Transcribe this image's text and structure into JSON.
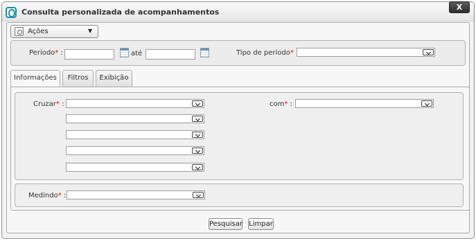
{
  "window": {
    "title": "Consulta personalizada de acompanhamentos",
    "close_label": "X"
  },
  "toolbar": {
    "actions_label": "Ações",
    "actions_caret": "▼"
  },
  "period": {
    "label": "Período",
    "required_mark": "*",
    "separator": ":",
    "start_value": "",
    "between_label": "até",
    "end_value": "",
    "type_label": "Tipo de período",
    "type_value": ""
  },
  "tabs": [
    {
      "label": "Informações",
      "active": true
    },
    {
      "label": "Filtros",
      "active": false
    },
    {
      "label": "Exibição",
      "active": false
    }
  ],
  "info": {
    "cross_label": "Cruzar",
    "cross_values": [
      "",
      "",
      "",
      "",
      ""
    ],
    "with_label": "com",
    "with_value": ""
  },
  "measure": {
    "label": "Medindo",
    "value": ""
  },
  "footer": {
    "search_label": "Pesquisar",
    "clear_label": "Limpar"
  },
  "colors": {
    "required": "#e01010",
    "accent": "#1a8fa8"
  }
}
